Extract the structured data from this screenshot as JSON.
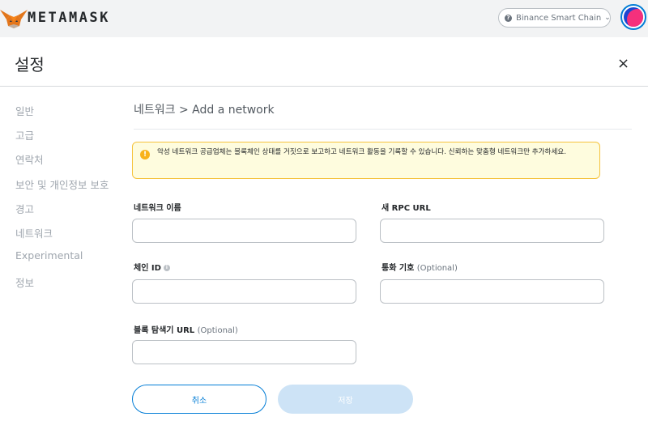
{
  "app": {
    "brand": "METAMASK",
    "network": "Binance Smart Chain"
  },
  "settings": {
    "title": "설정",
    "close": "×"
  },
  "sidebar": {
    "items": [
      {
        "label": "일반"
      },
      {
        "label": "고급"
      },
      {
        "label": "연락처"
      },
      {
        "label": "보안 및 개인정보 보호"
      },
      {
        "label": "경고"
      },
      {
        "label": "네트워크"
      },
      {
        "label": "Experimental"
      },
      {
        "label": "정보"
      }
    ]
  },
  "content": {
    "breadcrumb": "네트워크 > Add a network",
    "warning": "악성 네트워크 공급업체는 블록체인 상태를 거짓으로 보고하고 네트워크 활동을 기록할 수 있습니다. 신뢰하는 맞춤형 네트워크만 추가하세요.",
    "fields": {
      "network_name": {
        "label": "네트워크 이름",
        "value": ""
      },
      "rpc_url": {
        "label": "새 RPC URL",
        "value": ""
      },
      "chain_id": {
        "label": "체인 ID",
        "value": ""
      },
      "currency_symbol": {
        "label": "통화 기호",
        "optional": "(Optional)",
        "value": ""
      },
      "explorer_url": {
        "label": "블록 탐색기 URL",
        "optional": "(Optional)",
        "value": ""
      }
    },
    "buttons": {
      "cancel": "취소",
      "save": "저장"
    }
  },
  "colors": {
    "accent": "#037dd6",
    "warning_bg": "#fefcde",
    "warning_border": "#f5c33d",
    "disabled_button": "#cde3f6"
  }
}
